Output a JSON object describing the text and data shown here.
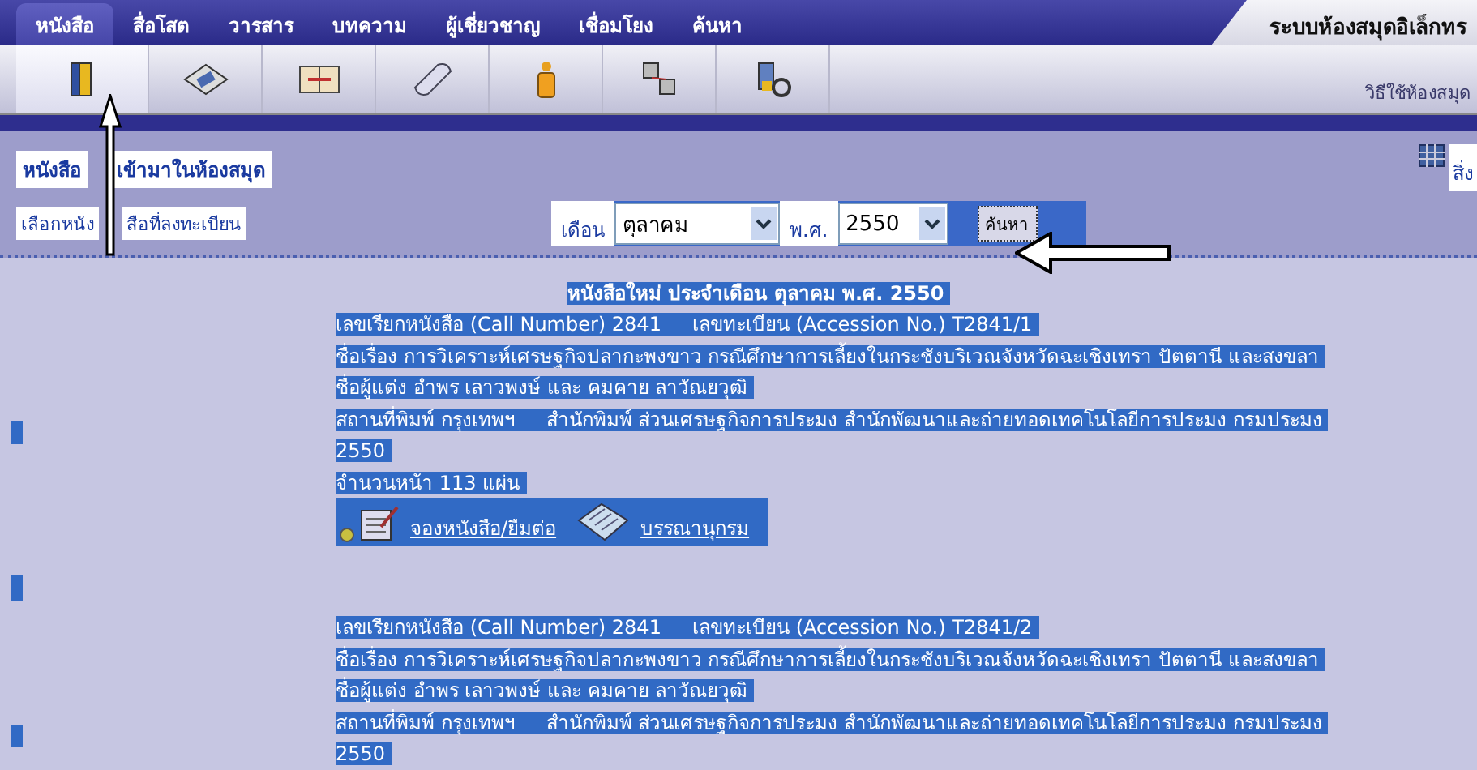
{
  "nav_tabs": [
    {
      "label": "หนังสือ",
      "selected": true
    },
    {
      "label": "สื่อโสต",
      "selected": false
    },
    {
      "label": "วารสาร",
      "selected": false
    },
    {
      "label": "บทความ",
      "selected": false
    },
    {
      "label": "ผู้เชี่ยวชาญ",
      "selected": false
    },
    {
      "label": "เชื่อมโยง",
      "selected": false
    },
    {
      "label": "ค้นหา",
      "selected": false
    }
  ],
  "site_title": "ระบบห้องสมุดอิเล็กทร",
  "toolbar": [
    {
      "kind": "book",
      "selected": true
    },
    {
      "kind": "film",
      "selected": false
    },
    {
      "kind": "journal",
      "selected": false
    },
    {
      "kind": "scroll",
      "selected": false
    },
    {
      "kind": "person",
      "selected": false
    },
    {
      "kind": "network",
      "selected": false
    },
    {
      "kind": "search",
      "selected": false
    }
  ],
  "help_link": "วิธีใช้ห้องสมุด",
  "section_title": [
    "หนังสือ",
    "เข้ามาในห้องสมุด"
  ],
  "register_link": [
    "เลือกหนัง",
    "สือที่ลงทะเบียน"
  ],
  "side_link": "สิ่ง",
  "filter": {
    "month_label": "เดือน",
    "month": "ตุลาคม",
    "year_label": "พ.ศ.",
    "year": "2550",
    "search_button": "ค้นหา"
  },
  "results": {
    "text_selected": true,
    "heading": "หนังสือใหม่ ประจำเดือน ตุลาคม พ.ศ. 2550",
    "records": [
      {
        "lines": [
          "เลขเรียกหนังสือ (Call Number) 2841     เลขทะเบียน (Accession No.) T2841/1",
          "ชื่อเรื่อง การวิเคราะห์เศรษฐกิจปลากะพงขาว กรณีศึกษาการเลี้ยงในกระชังบริเวณจังหวัดฉะเชิงเทรา ปัตตานี และสงขลา",
          "ชื่อผู้แต่ง อำพร เลาวพงษ์ และ คมคาย ลาวัณยวุฒิ",
          "สถานที่พิมพ์ กรุงเทพฯ     สำนักพิมพ์ ส่วนเศรษฐกิจการประมง สำนักพัฒนาและถ่ายทอดเทคโนโลยีการประมง กรมประมง",
          "2550",
          "จำนวนหน้า 113 แผ่น"
        ],
        "actions": [
          "จองหนังสือ/ยืมต่อ",
          "บรรณานุกรม"
        ]
      },
      {
        "lines": [
          "เลขเรียกหนังสือ (Call Number) 2841     เลขทะเบียน (Accession No.) T2841/2",
          "ชื่อเรื่อง การวิเคราะห์เศรษฐกิจปลากะพงขาว กรณีศึกษาการเลี้ยงในกระชังบริเวณจังหวัดฉะเชิงเทรา ปัตตานี และสงขลา",
          "ชื่อผู้แต่ง อำพร เลาวพงษ์ และ คมคาย ลาวัณยวุฒิ",
          "สถานที่พิมพ์ กรุงเทพฯ     สำนักพิมพ์ ส่วนเศรษฐกิจการประมง สำนักพัฒนาและถ่ายทอดเทคโนโลยีการประมง กรมประมง",
          "2550"
        ]
      }
    ]
  }
}
